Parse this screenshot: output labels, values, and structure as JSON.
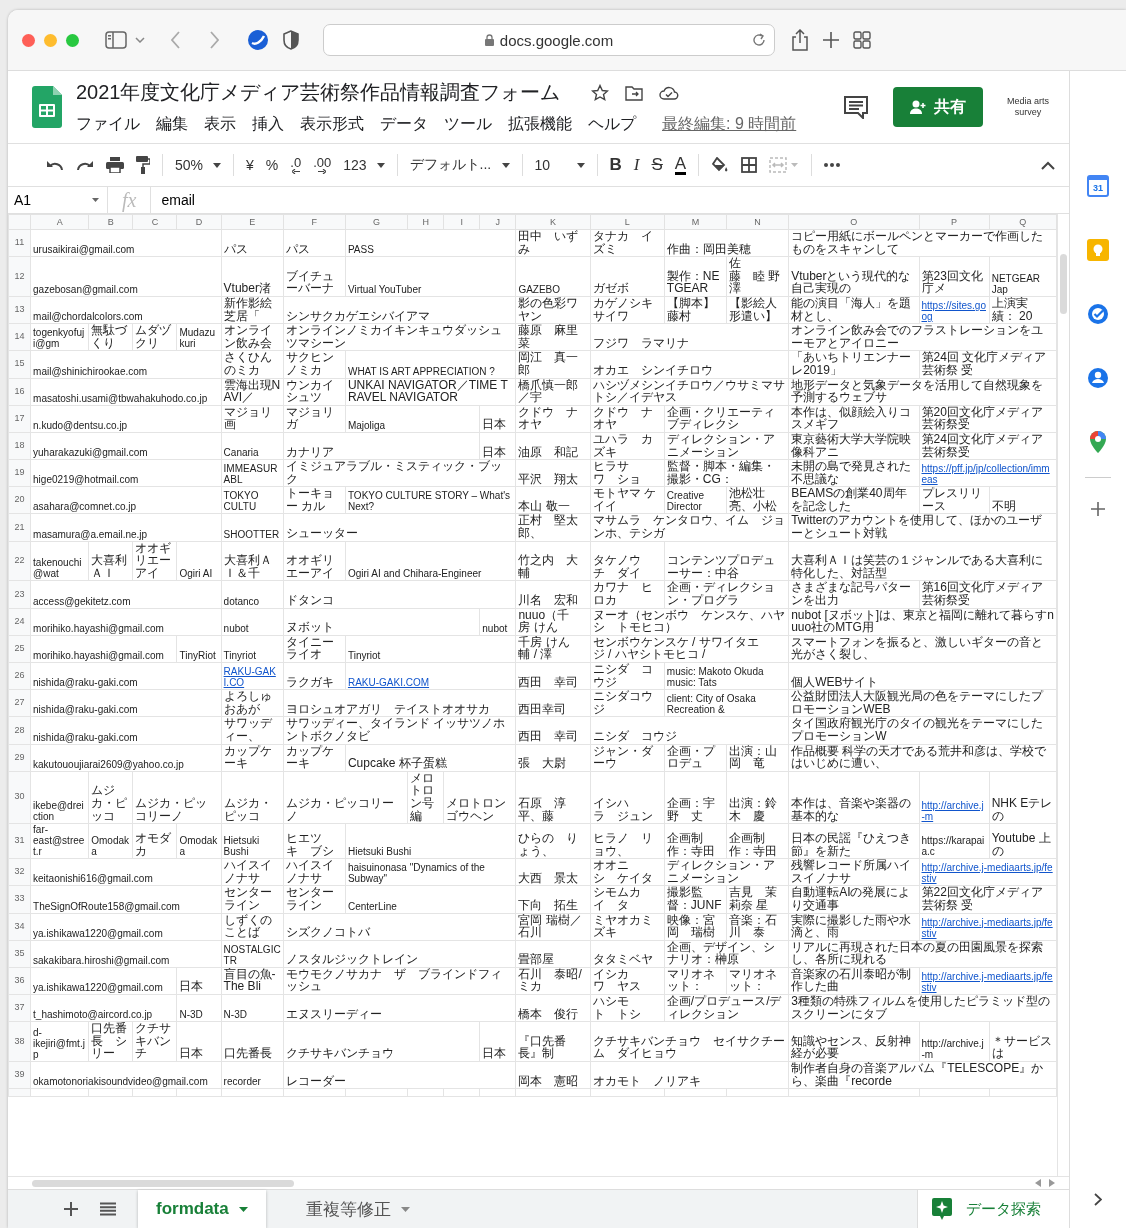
{
  "browser": {
    "address": "docs.google.com"
  },
  "document": {
    "title": "2021年度文化庁メディア芸術祭作品情報調査フォーム",
    "last_edit": "最終編集: 9 時間前",
    "share_button": "共有",
    "account_label": "Media arts survey"
  },
  "menu": [
    "ファイル",
    "編集",
    "表示",
    "挿入",
    "表示形式",
    "データ",
    "ツール",
    "拡張機能",
    "ヘルプ"
  ],
  "toolbar": {
    "zoom": "50%",
    "currency": "¥",
    "percent": "%",
    "decrease_decimal": ".0",
    "increase_decimal": ".00",
    "number_format": "123",
    "font": "デフォルト...",
    "font_size": "10",
    "bold": "B",
    "italic": "I",
    "strikethrough": "S",
    "text_color": "A"
  },
  "formula_bar": {
    "cell": "A1",
    "fx": "fx",
    "value": "email"
  },
  "columns": [
    "A",
    "B",
    "C",
    "D",
    "E",
    "F",
    "G",
    "H",
    "I",
    "J",
    "K",
    "L",
    "M",
    "N",
    "O",
    "P",
    "Q"
  ],
  "rows": [
    {
      "number": "11",
      "cells": [
        "urusaikirai@gmail.com",
        null,
        null,
        null,
        "パス",
        "パス",
        "PASS",
        null,
        null,
        null,
        "田中　いずみ",
        "タナカ　イズミ",
        "作曲：岡田美穂",
        null,
        "コピー用紙にボールペンとマーカーで作画したものをスキャンして",
        null,
        null
      ]
    },
    {
      "number": "12",
      "cells": [
        "gazebosan@gmail.com",
        null,
        null,
        null,
        "Vtuber渚",
        "ブイチューバーナ",
        "Virtual YouTuber",
        null,
        null,
        null,
        "GAZEBO",
        "ガゼボ",
        "製作：NETGEAR",
        "佐藤　睦 野澤",
        "Vtuberという現代的な自己実現の",
        "第23回文化庁メ",
        "NETGEAR Jap"
      ]
    },
    {
      "number": "13",
      "cells": [
        "mail@chordalcolors.com",
        null,
        null,
        null,
        "新作影絵芝居「",
        "シンサクカゲエシバイアマ",
        null,
        null,
        null,
        null,
        "影の色彩ワヤン",
        "カゲノシキサイワ",
        "【脚本】藤村",
        "【影絵人形遣い】",
        "能の演目「海人」を題材とし、",
        {
          "text": "https://sites.goog",
          "kind": "link"
        },
        "上演実績： 20"
      ]
    },
    {
      "number": "14",
      "cells": [
        "togenkyofuji@gm",
        "無駄づくり",
        "ムダヅクリ",
        "Mudazukuri",
        "オンライン飲み会",
        "オンラインノミカイキンキュウダッシュツマシーン",
        null,
        null,
        null,
        null,
        "藤原　麻里菜",
        "フジワ　ラマリナ",
        null,
        null,
        "オンライン飲み会でのフラストレーションをユーモアとアイロニー",
        null,
        null
      ]
    },
    {
      "number": "15",
      "cells": [
        "mail@shinichirookae.com",
        null,
        null,
        null,
        "さくひんのミカ",
        "サクヒンノミカ",
        "WHAT IS ART APPRECIATION ?",
        null,
        null,
        null,
        "岡江　真一郎",
        "オカエ　シンイチロウ",
        null,
        null,
        "「あいちトリエンナーレ2019」",
        "第24回 文化庁メディア芸術祭 受",
        null
      ]
    },
    {
      "number": "16",
      "cells": [
        "masatoshi.usami@tbwahakuhodo.co.jp",
        null,
        null,
        null,
        "雲海出現NAVI／",
        "ウンカイシュツ",
        "UNKAI NAVIGATOR／TIME TRAVEL NAVIGATOR",
        null,
        null,
        null,
        "橋爪慎一郎／宇",
        "ハシヅメシンイチロウ／ウサミマサトシ／イデヤス",
        null,
        null,
        "地形データと気象データを活用して自然現象を予測するウェブサ",
        null,
        null
      ]
    },
    {
      "number": "17",
      "cells": [
        "n.kudo@dentsu.co.jp",
        null,
        null,
        null,
        "マジョリ画",
        "マジョリガ",
        "Majoliga",
        null,
        null,
        "日本",
        "クドウ　ナオヤ",
        "クドウ　ナオヤ",
        "企画・クリエーティブディレクシ",
        null,
        "本作は、似顔絵入りコスメギフ",
        "第20回文化庁メディア芸術祭受",
        null
      ]
    },
    {
      "number": "18",
      "cells": [
        "yuharakazuki@gmail.com",
        null,
        null,
        null,
        "Canaria",
        "カナリア",
        null,
        null,
        null,
        "日本",
        "油原　和記",
        "ユハラ　カズキ",
        "ディレクション・アニメーション",
        null,
        "東京藝術大学大学院映像科アニ",
        "第24回文化庁メディア芸術祭受",
        null
      ]
    },
    {
      "number": "19",
      "cells": [
        "hige0219@hotmail.com",
        null,
        null,
        null,
        "IMMEASURABL",
        "イミジュアラブル・ミスティック・ブック",
        null,
        null,
        null,
        null,
        "平沢　翔太",
        "ヒラサワ　ショ",
        "監督・脚本・編集・撮影・CG：",
        null,
        "未開の島で発見された不思議な",
        {
          "text": "https://pff.jp/jp/collection/immeas",
          "kind": "link"
        },
        null
      ]
    },
    {
      "number": "20",
      "cells": [
        "asahara@comnet.co.jp",
        null,
        null,
        null,
        "TOKYO CULTU",
        "トーキョー カル",
        "TOKYO CULTURE STORY – What's Next?",
        null,
        null,
        null,
        "本山 敬一",
        "モトヤマ ケイイ",
        "Creative Director",
        "池松壮亮、小松",
        "BEAMSの創業40周年を記念した",
        "プレスリリース",
        "不明"
      ]
    },
    {
      "number": "21",
      "cells": [
        "masamura@a.email.ne.jp",
        null,
        null,
        null,
        "SHOOTTER",
        "シューッター",
        null,
        null,
        null,
        null,
        "正村　堅太郎、",
        "マサムラ　ケンタロウ、イム　ジョンホ、テシガ",
        null,
        null,
        "Twitterのアカウントを使用して、ほかのユーザーとシュート対戦",
        null,
        null
      ]
    },
    {
      "number": "22",
      "cells": [
        "takenouchi@wat",
        "大喜利ＡＩ",
        "オオギリエーアイ",
        "Ogiri AI",
        "大喜利ＡＩ＆千",
        "オオギリエーアイ",
        "Ogiri AI and Chihara-Engineer",
        null,
        null,
        null,
        "竹之内　大輔",
        "タケノウチ　ダイ",
        "コンテンツプロデューサー：中谷",
        null,
        "大喜利ＡＩは笑芸の１ジャンルである大喜利に特化した、対話型",
        null,
        null
      ]
    },
    {
      "number": "23",
      "cells": [
        "access@gekitetz.com",
        null,
        null,
        null,
        "dotanco",
        "ドタンコ",
        null,
        null,
        null,
        null,
        "川名　宏和",
        "カワナ　ヒロカ",
        "企画・ディレクション・プログラ",
        null,
        "さまざまな記号パターンを出力",
        "第16回文化庁メディア芸術祭受",
        null
      ]
    },
    {
      "number": "24",
      "cells": [
        "morihiko.hayashi@gmail.com",
        null,
        null,
        null,
        "nubot",
        "ヌボット",
        null,
        null,
        null,
        "nubot",
        "nuuo（千房 けん",
        "ヌーオ（センボウ　ケンスケ、ハヤシ　トモヒコ）",
        null,
        null,
        "nubot [ヌボット]は、東京と福岡に離れて暮らすnuuo社のMTG用",
        null,
        null
      ]
    },
    {
      "number": "25",
      "cells": [
        "morihiko.hayashi@gmail.com",
        null,
        null,
        "TinyRiot",
        "Tinyriot",
        "タイニーライオ",
        "Tinyriot",
        null,
        null,
        null,
        "千房 けん輔 / 澤",
        "センボウケンスケ / サワイタエジ / ハヤシトモヒコ /",
        null,
        null,
        "スマートフォンを振ると、激しいギターの音と光がさく裂し、",
        null,
        null
      ]
    },
    {
      "number": "26",
      "cells": [
        "nishida@raku-gaki.com",
        null,
        null,
        null,
        {
          "text": "RAKU-GAKI.CO",
          "kind": "link"
        },
        "ラクガキ",
        {
          "text": "RAKU-GAKI.COM",
          "kind": "link"
        },
        null,
        null,
        null,
        "西田　幸司",
        "ニシダ　コウジ",
        "music: Makoto Okuda music: Tats",
        null,
        "個人WEBサイト",
        null,
        null
      ]
    },
    {
      "number": "27",
      "cells": [
        "nishida@raku-gaki.com",
        null,
        null,
        null,
        "よろしゅおあが",
        "ヨロシュオアガリ　テイストオオサカ",
        null,
        null,
        null,
        null,
        "西田幸司",
        "ニシダコウジ",
        "client: City of Osaka Recreation &",
        null,
        "公益財団法人大阪観光局の色をテーマにしたプロモーションWEB",
        null,
        null
      ]
    },
    {
      "number": "28",
      "cells": [
        "nishida@raku-gaki.com",
        null,
        null,
        null,
        "サワッディー、",
        "サワッディー、タイランド イッサツノホントボクノタビ",
        null,
        null,
        null,
        null,
        "西田　幸司",
        "ニシダ　コウジ",
        null,
        null,
        "タイ国政府観光庁のタイの観光をテーマにしたプロモーションW",
        null,
        null
      ]
    },
    {
      "number": "29",
      "cells": [
        "kakutououjiarai2609@yahoo.co.jp",
        null,
        null,
        null,
        "カップケーキ",
        "カップケーキ",
        "Cupcake 杯子蛋糕",
        null,
        null,
        null,
        "張　大尉",
        "ジャン・ダーウ",
        "企画・プロデュ",
        "出演：山岡　竜",
        "作品概要 科学の天才である荒井和彦は、学校ではいじめに遭い、",
        null,
        null
      ]
    },
    {
      "number": "30",
      "cells": [
        "ikebe@dreiction",
        "ムジカ・ピッコ",
        "ムジカ・ピッコリーノ",
        null,
        "ムジカ・ピッコ",
        "ムジカ・ピッコリーノ",
        null,
        "メロトロン号編",
        "メロトロンゴウヘン",
        null,
        "石原　淳平、藤",
        "イシハラ　ジュン",
        "企画：宇野　丈",
        "出演：鈴木　慶",
        "本作は、音楽や楽器の基本的な",
        {
          "text": "http://archive.j-m",
          "kind": "link"
        },
        "NHK Eテレの"
      ]
    },
    {
      "number": "31",
      "cells": [
        "far-east@street.r",
        "Omodaka",
        "オモダカ",
        "Omodaka",
        "Hietsuki Bushi",
        "ヒエツキ　ブシ",
        "Hietsuki Bushi",
        null,
        null,
        null,
        "ひらの　りょう、",
        "ヒラノ　リョウ、",
        "企画制作：寺田",
        "企画制作：寺田",
        "日本の民謡『ひえつき節』を新た",
        "https://karapaia.c",
        "Youtube 上の"
      ]
    },
    {
      "number": "32",
      "cells": [
        "keitaonishi616@gmail.com",
        null,
        null,
        null,
        "ハイスイノナサ",
        "ハイスイノナサ",
        "haisuinonasa \"Dynamics of the Subway\"",
        null,
        null,
        null,
        "大西　景太",
        "オオニシ　ケイタ",
        "ディレクション・アニメーション",
        null,
        "残響レコード所属ハイスイノナサ",
        {
          "text": "http://archive.j-mediaarts.jp/festiv",
          "kind": "link"
        },
        null
      ]
    },
    {
      "number": "33",
      "cells": [
        "TheSignOfRoute158@gmail.com",
        null,
        null,
        null,
        "センターライン",
        "センターライン",
        "CenterLine",
        null,
        null,
        null,
        "下向　拓生",
        "シモムカイ　タ",
        "撮影監督：JUNF",
        "吉見　茉莉奈 星",
        "自動運転AIの発展により交通事",
        "第22回文化庁メディア芸術祭 受",
        null
      ]
    },
    {
      "number": "34",
      "cells": [
        "ya.ishikawa1220@gmail.com",
        null,
        null,
        null,
        "しずくのことば",
        "シズクノコトバ",
        null,
        null,
        null,
        null,
        "宮岡 瑞樹／石川",
        "ミヤオカミズキ",
        "映像：宮岡　瑞樹",
        "音楽：石川　泰",
        "実際に撮影した雨や水滴と、雨",
        {
          "text": "http://archive.j-mediaarts.jp/festiv",
          "kind": "link"
        },
        null
      ]
    },
    {
      "number": "35",
      "cells": [
        "sakakibara.hiroshi@gmail.com",
        null,
        null,
        null,
        "NOSTALGIC TR",
        "ノスタルジックトレイン",
        null,
        null,
        null,
        null,
        "畳部屋",
        "タタミベヤ",
        "企画、デザイン、シナリオ：榊原",
        null,
        "リアルに再現された日本の夏の田園風景を探索し、各所に現れる",
        null,
        null
      ]
    },
    {
      "number": "36",
      "cells": [
        "ya.ishikawa1220@gmail.com",
        null,
        null,
        "日本",
        "盲目の魚-The Bli",
        "モウモクノサカナ　ザ　ブラインドフィッシュ",
        null,
        null,
        null,
        null,
        "石川　泰昭/ミカ",
        "イシカワ　ヤス",
        "マリオネット：",
        "マリオネット：",
        "音楽家の石川泰昭が制作した曲",
        {
          "text": "http://archive.j-mediaarts.jp/festiv",
          "kind": "link"
        },
        null
      ]
    },
    {
      "number": "37",
      "cells": [
        "t_hashimoto@aircord.co.jp",
        null,
        null,
        "N-3D",
        "N-3D",
        "エヌスリーディー",
        null,
        null,
        null,
        null,
        "橋本　俊行",
        "ハシモト　トシ",
        "企画/プロデュース/ディレクション",
        null,
        "3種類の特殊フィルムを使用したピラミッド型のスクリーンにタブ",
        null,
        null
      ]
    },
    {
      "number": "38",
      "cells": [
        "d-ikejiri@fmt.jp",
        "口先番長　シリー",
        "クチサキバンチ",
        "日本",
        "口先番長",
        "クチサキバンチョウ",
        null,
        null,
        null,
        "日本",
        "『口先番長』制",
        "クチサキバンチョウ　セイサクチーム　ダイヒョウ",
        null,
        null,
        "知識やセンス、反射神経が必要",
        "http://archive.j-m",
        "＊サービスは"
      ]
    },
    {
      "number": "39",
      "cells": [
        "okamotonoriakisoundvideo@gmail.com",
        null,
        null,
        null,
        "recorder",
        "レコーダー",
        null,
        null,
        null,
        null,
        "岡本　憲昭",
        "オカモト　ノリアキ",
        null,
        null,
        "制作者自身の音楽アルバム『TELESCOPE』から、楽曲『recorde",
        null,
        null
      ]
    }
  ],
  "side_panel": {
    "calendar_day": "31"
  },
  "sheet_tabs": [
    {
      "label": "formdata",
      "selected": true
    },
    {
      "label": "重複等修正",
      "selected": false
    }
  ],
  "explore_button": "データ探索"
}
